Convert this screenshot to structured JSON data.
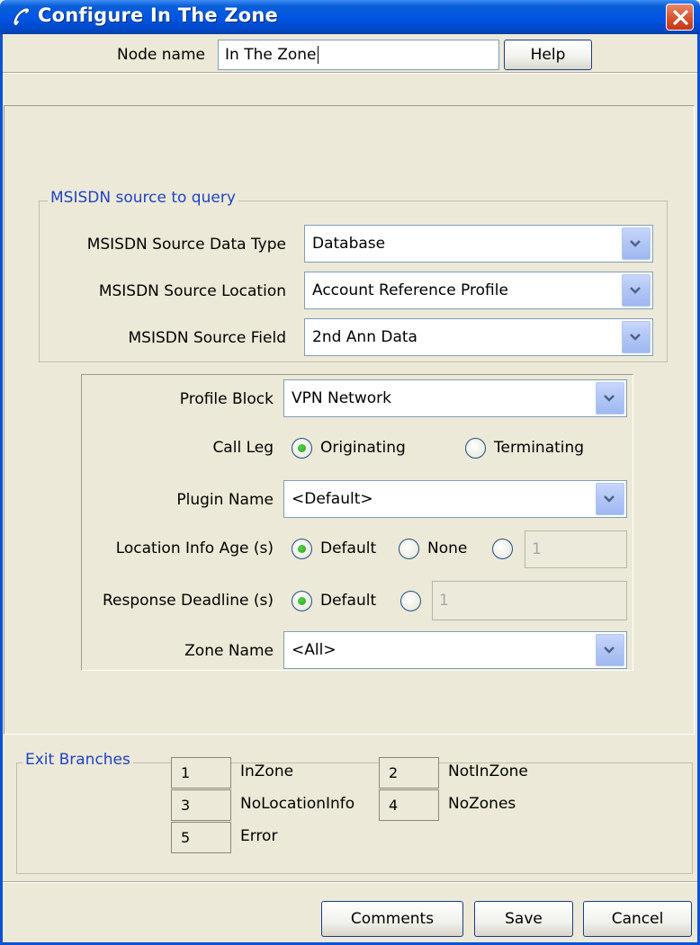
{
  "window": {
    "title": "Configure In The Zone",
    "close_icon": "close-icon",
    "app_icon": "phone-handset-icon"
  },
  "header": {
    "node_name_label": "Node name",
    "node_name_value": "In The Zone",
    "help_label": "Help"
  },
  "msisdn_group": {
    "title": "MSISDN source to query",
    "rows": [
      {
        "label": "MSISDN Source Data Type",
        "value": "Database"
      },
      {
        "label": "MSISDN Source Location",
        "value": "Account Reference Profile"
      },
      {
        "label": "MSISDN Source Field",
        "value": "2nd Ann Data"
      }
    ]
  },
  "profile": {
    "profile_block_label": "Profile Block",
    "profile_block_value": "VPN Network",
    "call_leg_label": "Call Leg",
    "call_leg_options": [
      "Originating",
      "Terminating"
    ],
    "call_leg_selected": "Originating",
    "plugin_name_label": "Plugin Name",
    "plugin_name_value": "<Default>",
    "location_info_age_label": "Location Info Age (s)",
    "location_info_age_options": [
      "Default",
      "None"
    ],
    "location_info_age_selected": "Default",
    "location_info_age_value": "1",
    "response_deadline_label": "Response Deadline (s)",
    "response_deadline_option": "Default",
    "response_deadline_value": "1",
    "zone_name_label": "Zone Name",
    "zone_name_value": "<All>"
  },
  "exit_branches": {
    "title": "Exit Branches",
    "branches": [
      {
        "number": "1",
        "name": "InZone"
      },
      {
        "number": "2",
        "name": "NotInZone"
      },
      {
        "number": "3",
        "name": "NoLocationInfo"
      },
      {
        "number": "4",
        "name": "NoZones"
      },
      {
        "number": "5",
        "name": "Error"
      }
    ]
  },
  "footer": {
    "comments_label": "Comments",
    "save_label": "Save",
    "cancel_label": "Cancel"
  },
  "colors": {
    "titlebar": "#0054e3",
    "dialog_bg": "#ece9d8",
    "group_title": "#1f43c6",
    "radio_selected": "#21a121",
    "close_button": "#d8522f"
  }
}
